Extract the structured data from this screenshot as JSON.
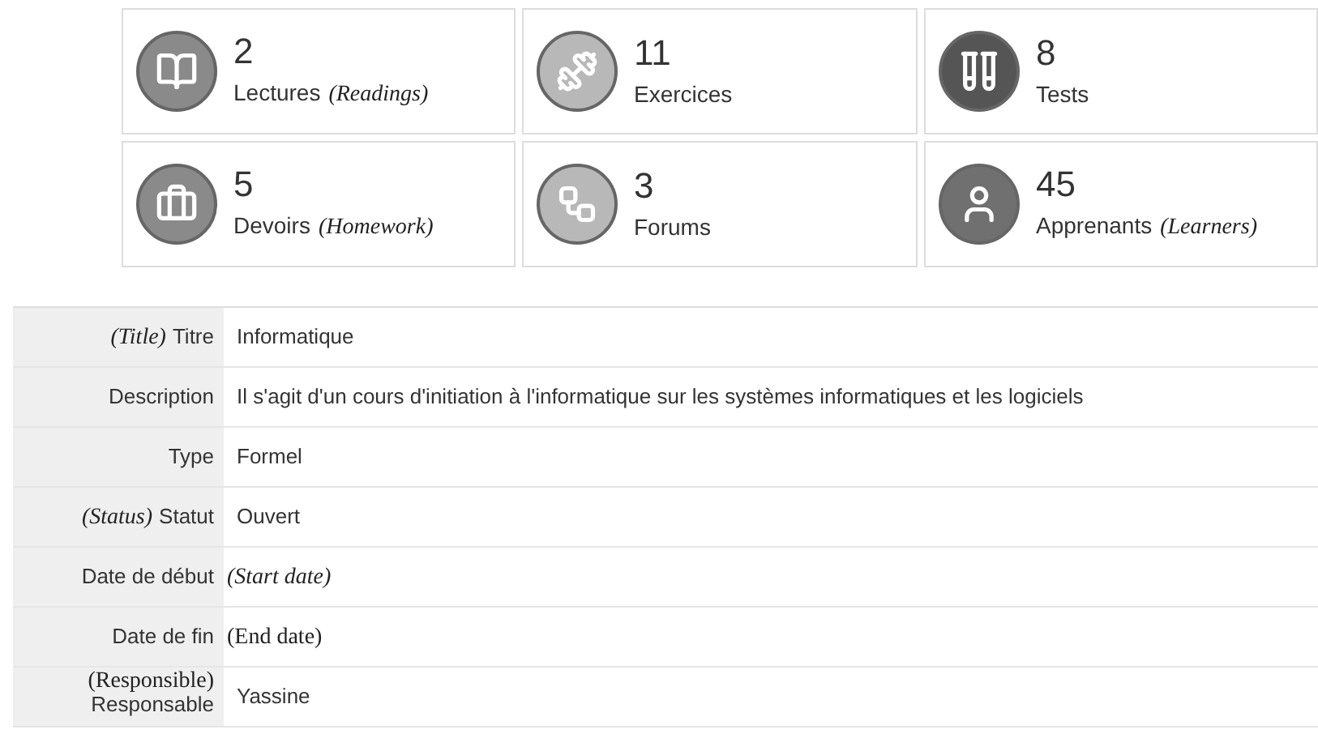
{
  "stats": [
    {
      "kind": "book",
      "color": "#8a8a8a",
      "count": "2",
      "label": "Lectures",
      "note": "(Readings)"
    },
    {
      "kind": "dumbbell",
      "color": "#b8b8b8",
      "count": "11",
      "label": "Exercices"
    },
    {
      "kind": "tubes",
      "color": "#555555",
      "count": "8",
      "label": "Tests"
    },
    {
      "kind": "briefcase",
      "color": "#8a8a8a",
      "count": "5",
      "label": "Devoirs",
      "note": "(Homework)"
    },
    {
      "kind": "flowchart",
      "color": "#b8b8b8",
      "count": "3",
      "label": "Forums"
    },
    {
      "kind": "user",
      "color": "#707070",
      "count": "45",
      "label": "Apprenants",
      "note": "(Learners)"
    }
  ],
  "details": [
    {
      "label": "Titre",
      "note": "(Title)",
      "kind": "prefix",
      "italic": true,
      "value": "Informatique"
    },
    {
      "label": "Description",
      "value": "Il s'agit d'un cours d'initiation à l'informatique sur les systèmes informatiques et les logiciels"
    },
    {
      "label": "Type",
      "value": "Formel"
    },
    {
      "label": "Statut",
      "note": "(Status)",
      "kind": "prefix",
      "italic": true,
      "value": "Ouvert"
    },
    {
      "label": "Date de début",
      "note": "(Start date)",
      "kind": "inline",
      "italic": true
    },
    {
      "label": "Date de fin",
      "note": "(End date)",
      "kind": "inline",
      "italic": false
    },
    {
      "label": "Responsable",
      "note": "(Responsible)",
      "kind": "above",
      "italic": false,
      "value": "Yassine"
    }
  ]
}
